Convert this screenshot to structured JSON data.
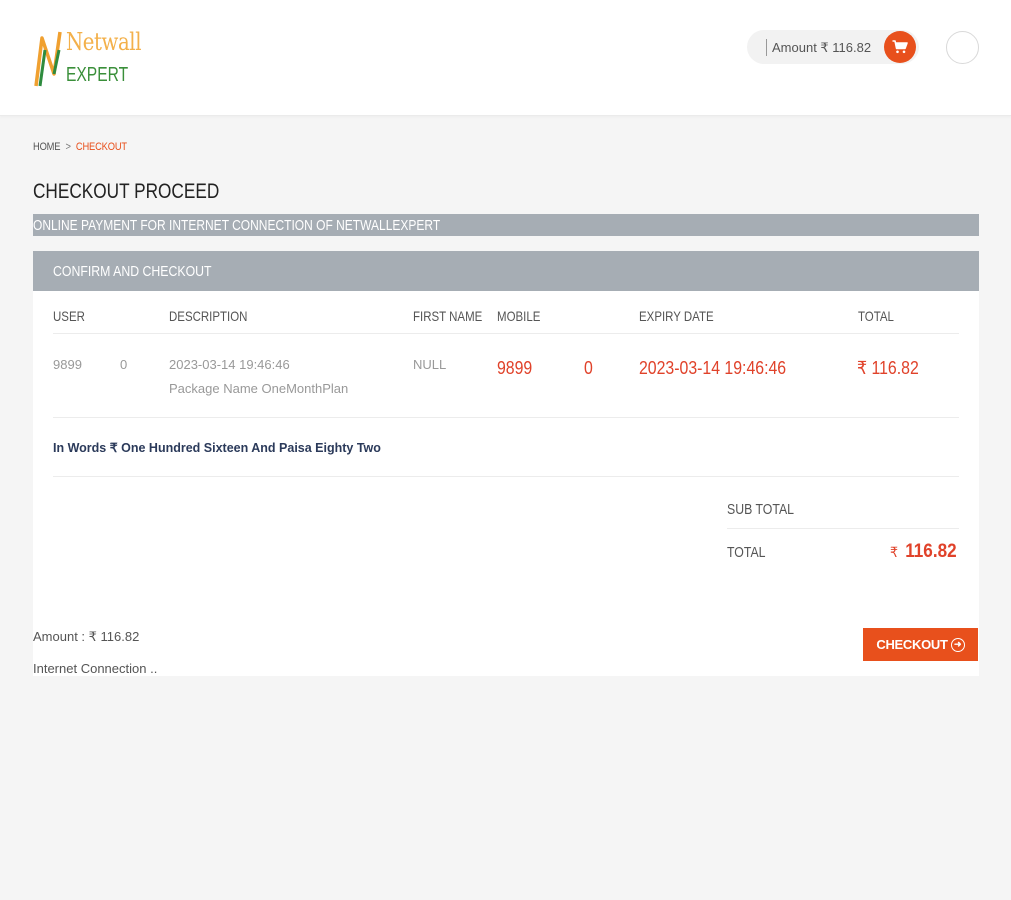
{
  "header": {
    "logo": {
      "line1": "Netwall",
      "line2": "EXPERT"
    },
    "amount_label": "Amount ₹ 116.82",
    "cart_icon": "cart-icon",
    "avatar": ""
  },
  "breadcrumb": {
    "home": "HOME",
    "separator": ">",
    "current": "CHECKOUT"
  },
  "page_title": "CHECKOUT PROCEED",
  "online_banner": "ONLINE PAYMENT FOR INTERNET CONNECTION OF NETWALLEXPERT",
  "card": {
    "title": "CONFIRM AND CHECKOUT",
    "columns": [
      "USER",
      "DESCRIPTION",
      "FIRST NAME",
      "MOBILE",
      "EXPIRY DATE",
      "TOTAL"
    ],
    "row": {
      "user_a": "9899",
      "user_b": "0",
      "description_date": "2023-03-14 19:46:46",
      "description_package": "Package Name OneMonthPlan",
      "first_name": "NULL",
      "mobile_a": "9899",
      "mobile_b": "0",
      "expiry_date": "2023-03-14 19:46:46",
      "total": "₹ 116.82"
    },
    "in_words": "In Words ₹ One Hundred Sixteen And Paisa Eighty Two",
    "sub_total_label": "SUB TOTAL",
    "total_label": "TOTAL",
    "total_currency": "₹",
    "total_value": "116.82"
  },
  "footer": {
    "amount": "Amount : ₹ 116.82",
    "description": "Internet Connection ..",
    "checkout_label": "CHECKOUT",
    "checkout_icon": "arrow-right-circle-icon"
  },
  "colors": {
    "accent": "#e8501c",
    "price_red": "#e0422a",
    "bar_gray": "#a6adb4"
  }
}
